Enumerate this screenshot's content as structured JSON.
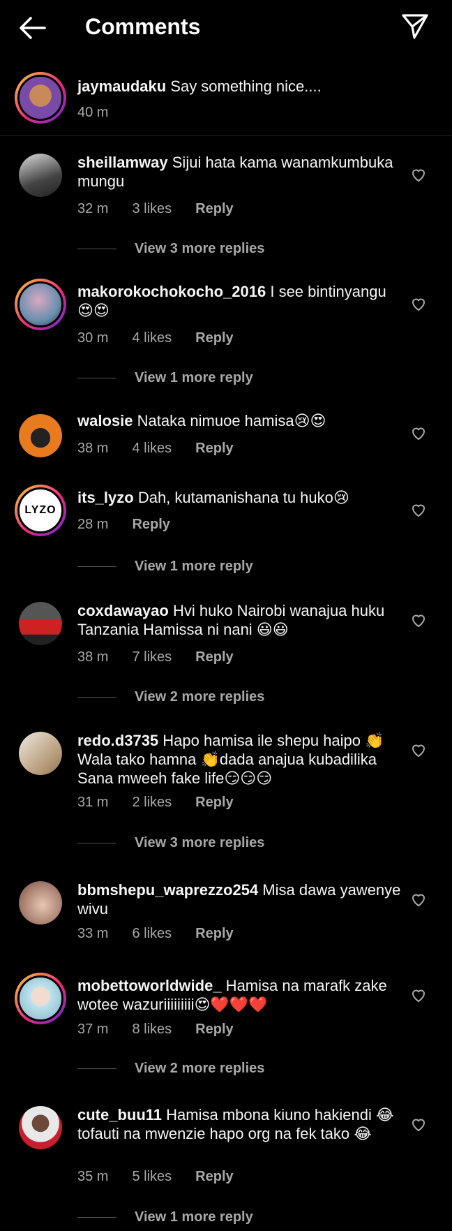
{
  "header": {
    "title": "Comments",
    "back_icon": "arrow-left-icon",
    "share_icon": "paper-plane-icon"
  },
  "caption": {
    "username": "jaymaudaku",
    "text": " Say something nice....",
    "time": "40 m"
  },
  "comments": [
    {
      "username": "sheillamway",
      "text": " Sijui hata kama wanamkumbuka mungu",
      "time": "32 m",
      "likes": "3 likes",
      "reply": "Reply",
      "more": "View 3 more replies"
    },
    {
      "username": "makorokochokocho_2016",
      "text": " I see bintinyangu 😍😍",
      "time": "30 m",
      "likes": "4 likes",
      "reply": "Reply",
      "more": "View 1 more reply"
    },
    {
      "username": "walosie",
      "text": " Nataka nimuoe hamisa😢😍",
      "time": "38 m",
      "likes": "4 likes",
      "reply": "Reply",
      "more": ""
    },
    {
      "username": "its_lyzo",
      "text": " Dah, kutamanishana tu huko😢",
      "time": "28 m",
      "likes": "",
      "reply": "Reply",
      "more": "View 1 more reply"
    },
    {
      "username": "coxdawayao",
      "text": " Hvi huko Nairobi wanajua huku Tanzania Hamissa ni nani 😃😃",
      "time": "38 m",
      "likes": "7 likes",
      "reply": "Reply",
      "more": "View 2 more replies"
    },
    {
      "username": "redo.d3735",
      "text": " Hapo hamisa ile shepu haipo 👏Wala tako hamna 👏dada anajua kubadilika Sana mweeh fake life😏😏😏",
      "time": "31 m",
      "likes": "2 likes",
      "reply": "Reply",
      "more": "View 3 more replies"
    },
    {
      "username": "bbmshepu_waprezzo254",
      "text": " Misa dawa yawenye wivu",
      "time": "33 m",
      "likes": "6 likes",
      "reply": "Reply",
      "more": ""
    },
    {
      "username": "mobettoworldwide_",
      "text": " Hamisa na marafk zake wotee wazuriiiiiiiii😍❤️❤️❤️",
      "time": "37 m",
      "likes": "8 likes",
      "reply": "Reply",
      "more": "View 2 more replies"
    },
    {
      "username": "cute_buu11",
      "text": " Hamisa mbona kiuno hakiendi 😂 tofauti na mwenzie hapo org na fek tako 😂",
      "time": "35 m",
      "likes": "5 likes",
      "reply": "Reply",
      "more": "View 1 more reply"
    }
  ],
  "lyzo_avatar_text": "LYZO",
  "colors": {
    "background": "#000000",
    "secondary_text": "#a8a8a8",
    "divider": "#262626"
  }
}
